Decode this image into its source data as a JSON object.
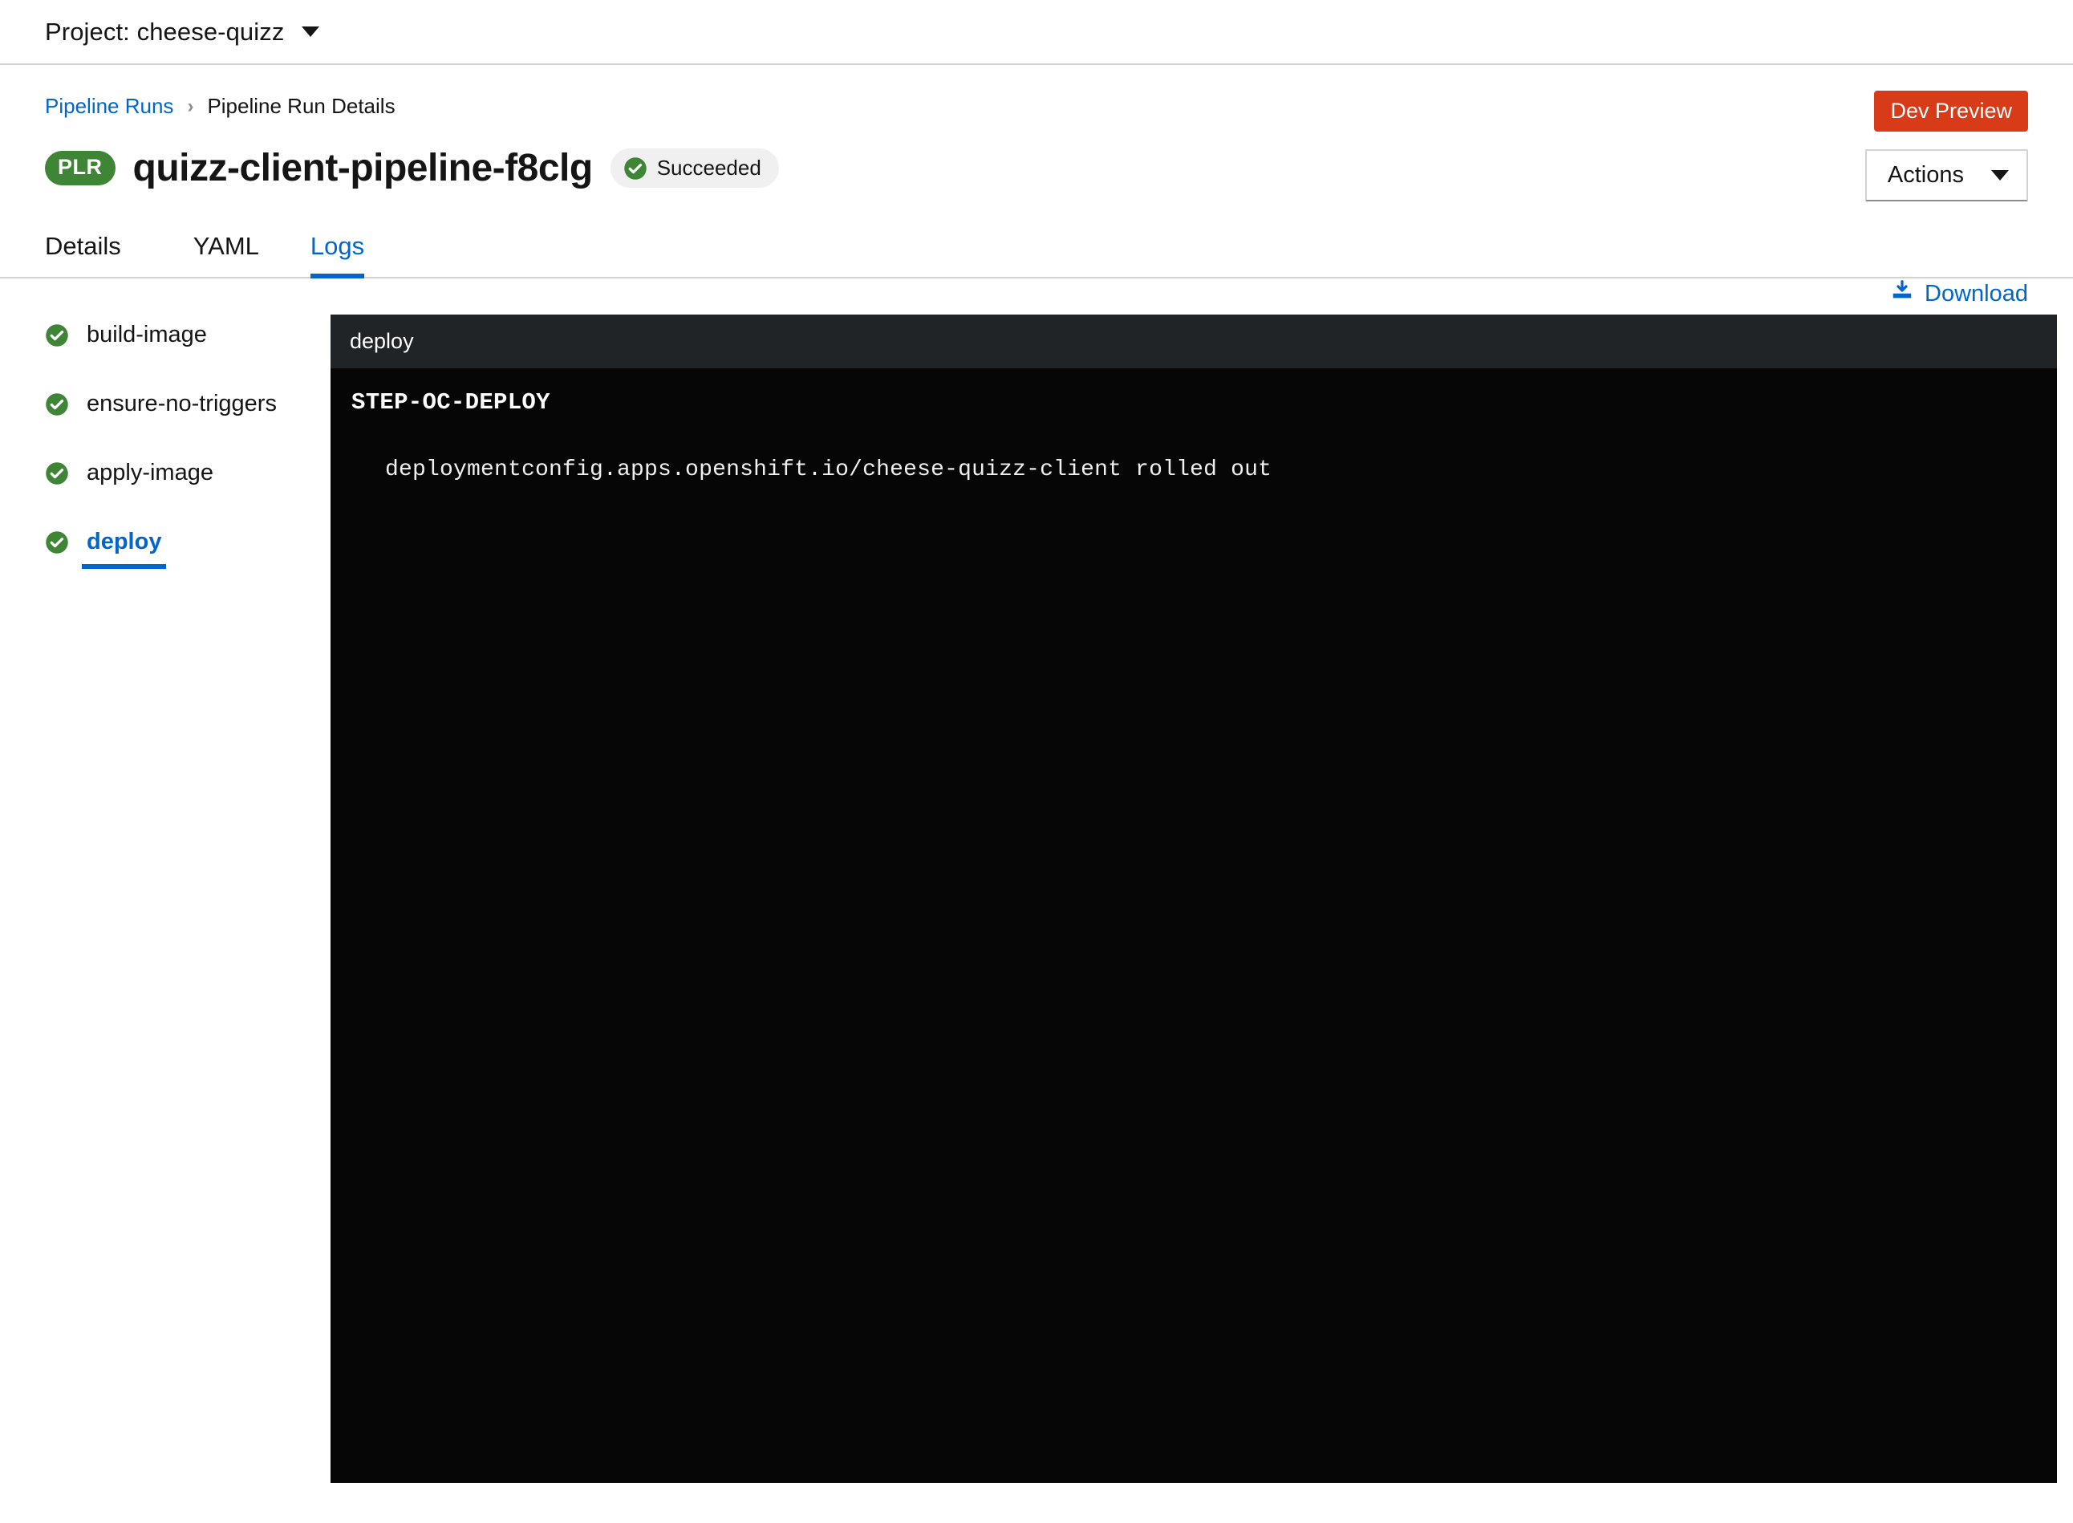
{
  "project_bar": {
    "selector_label": "Project: cheese-quizz",
    "caret_icon": "chevron-down-icon"
  },
  "breadcrumb": {
    "parent": "Pipeline Runs",
    "separator": "›",
    "current": "Pipeline Run Details"
  },
  "header": {
    "kind_badge": "PLR",
    "title": "quizz-client-pipeline-f8clg",
    "status": {
      "label": "Succeeded",
      "icon": "check-circle-icon",
      "color": "#3e8635"
    },
    "dev_preview_label": "Dev Preview",
    "dev_preview_color": "#d73b17",
    "actions_label": "Actions",
    "actions_caret_icon": "chevron-down-icon"
  },
  "tabs": [
    {
      "label": "Details",
      "active": false
    },
    {
      "label": "YAML",
      "active": false
    },
    {
      "label": "Logs",
      "active": true
    }
  ],
  "tasks": [
    {
      "label": "build-image",
      "status_icon": "check-circle-icon",
      "selected": false
    },
    {
      "label": "ensure-no-triggers",
      "status_icon": "check-circle-icon",
      "selected": false
    },
    {
      "label": "apply-image",
      "status_icon": "check-circle-icon",
      "selected": false
    },
    {
      "label": "deploy",
      "status_icon": "check-circle-icon",
      "selected": true
    }
  ],
  "download": {
    "label": "Download",
    "icon": "download-icon"
  },
  "log_panel": {
    "header_title": "deploy",
    "step_title": "STEP-OC-DEPLOY",
    "lines": [
      "deploymentconfig.apps.openshift.io/cheese-quizz-client rolled out"
    ]
  },
  "colors": {
    "link": "#0066cc",
    "success_green": "#3e8635",
    "dev_preview_red": "#d73b17",
    "log_header_bg": "#212427",
    "log_body_bg": "#060606"
  }
}
